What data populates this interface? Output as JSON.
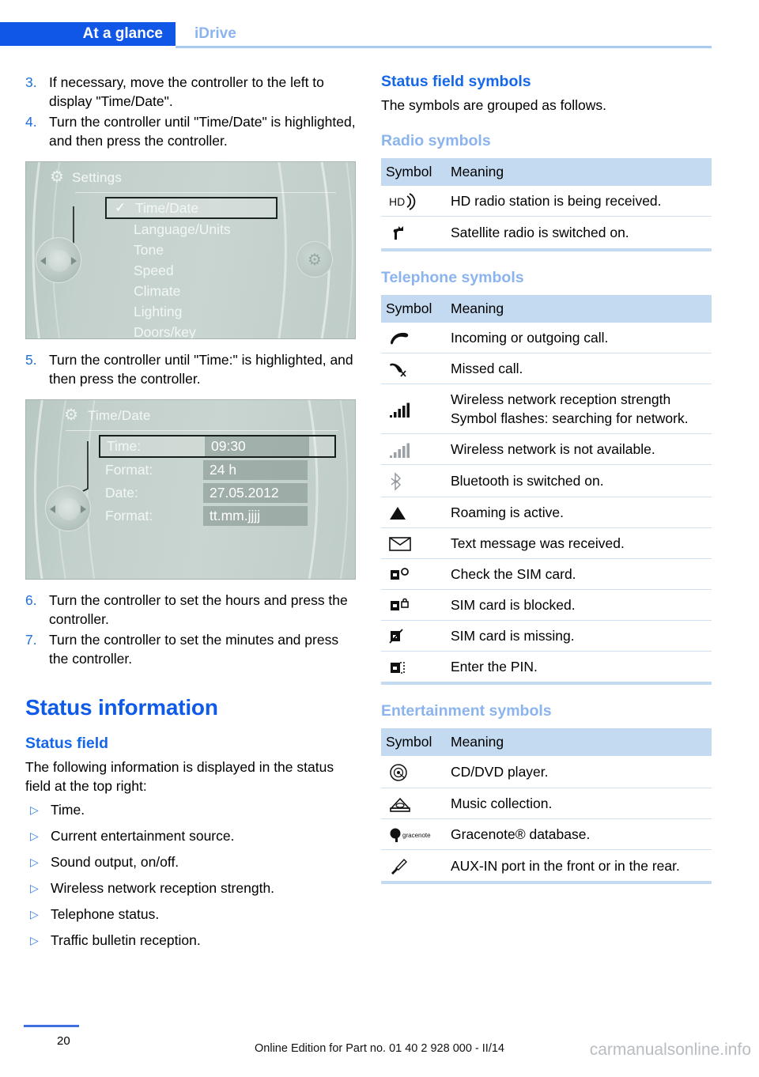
{
  "header": {
    "chapter_tab": "At a glance",
    "section": "iDrive"
  },
  "left_column": {
    "steps": [
      {
        "num": "3.",
        "text": "If necessary, move the controller to the left to display \"Time/Date\"."
      },
      {
        "num": "4.",
        "text": "Turn the controller until \"Time/Date\" is highlighted, and then press the controller."
      }
    ],
    "figure_settings": {
      "title": "Settings",
      "gear_icon": "gear-icon",
      "items": [
        {
          "label": "Time/Date",
          "selected": true,
          "checked": true
        },
        {
          "label": "Language/Units",
          "selected": false,
          "checked": false
        },
        {
          "label": "Tone",
          "selected": false,
          "checked": false
        },
        {
          "label": "Speed",
          "selected": false,
          "checked": false
        },
        {
          "label": "Climate",
          "selected": false,
          "checked": false
        },
        {
          "label": "Lighting",
          "selected": false,
          "checked": false
        },
        {
          "label": "Doors/key",
          "selected": false,
          "checked": false
        }
      ]
    },
    "step5": {
      "num": "5.",
      "text": "Turn the controller until \"Time:\" is highlighted, and then press the controller."
    },
    "figure_timedate": {
      "title": "Time/Date",
      "gear_icon": "gear-settings-icon",
      "rows": [
        {
          "label": "Time:",
          "value": "09:30",
          "selected": true
        },
        {
          "label": "Format:",
          "value": "24 h",
          "selected": false
        },
        {
          "label": "Date:",
          "value": "27.05.2012",
          "selected": false
        },
        {
          "label": "Format:",
          "value": "tt.mm.jjjj",
          "selected": false
        }
      ]
    },
    "steps_after": [
      {
        "num": "6.",
        "text": "Turn the controller to set the hours and press the controller."
      },
      {
        "num": "7.",
        "text": "Turn the controller to set the minutes and press the controller."
      }
    ],
    "status_information_heading": "Status information",
    "status_field_heading": "Status field",
    "status_field_intro": "The following information is displayed in the status field at the top right:",
    "status_field_items": [
      "Time.",
      "Current entertainment source.",
      "Sound output, on/off.",
      "Wireless network reception strength.",
      "Telephone status.",
      "Traffic bulletin reception."
    ],
    "bullet_glyph": "▷"
  },
  "right_column": {
    "status_field_symbols_heading": "Status field symbols",
    "status_field_symbols_intro": "The symbols are grouped as follows.",
    "radio_heading": "Radio symbols",
    "telephone_heading": "Telephone symbols",
    "entertainment_heading": "Entertainment symbols",
    "table_headers": {
      "symbol": "Symbol",
      "meaning": "Meaning"
    },
    "radio_rows": [
      {
        "icon": "hd-radio-icon",
        "meaning": "HD radio station is being received."
      },
      {
        "icon": "satellite-radio-icon",
        "meaning": "Satellite radio is switched on."
      }
    ],
    "telephone_rows": [
      {
        "icon": "phone-handset-icon",
        "meaning": "Incoming or outgoing call."
      },
      {
        "icon": "missed-call-icon",
        "meaning": "Missed call."
      },
      {
        "icon": "signal-bars-icon",
        "meaning": "Wireless network reception strength Symbol flashes: searching for network."
      },
      {
        "icon": "signal-bars-gray-icon",
        "meaning": "Wireless network is not available."
      },
      {
        "icon": "bluetooth-icon",
        "meaning": "Bluetooth is switched on."
      },
      {
        "icon": "roaming-triangle-icon",
        "meaning": "Roaming is active."
      },
      {
        "icon": "envelope-icon",
        "meaning": "Text message was received."
      },
      {
        "icon": "sim-check-icon",
        "meaning": "Check the SIM card."
      },
      {
        "icon": "sim-blocked-icon",
        "meaning": "SIM card is blocked."
      },
      {
        "icon": "sim-missing-icon",
        "meaning": "SIM card is missing."
      },
      {
        "icon": "sim-pin-icon",
        "meaning": "Enter the PIN."
      }
    ],
    "entertainment_rows": [
      {
        "icon": "cd-dvd-icon",
        "meaning": "CD/DVD player."
      },
      {
        "icon": "music-collection-icon",
        "meaning": "Music collection."
      },
      {
        "icon": "gracenote-icon",
        "meaning": "Gracenote® database.",
        "icon_text": "gracenote"
      },
      {
        "icon": "aux-in-icon",
        "meaning": "AUX-IN port in the front or in the rear."
      }
    ]
  },
  "footer": {
    "page_number": "20",
    "edition_note": "Online Edition for Part no. 01 40 2 928 000 - II/14",
    "watermark": "carmanualsonline.info"
  },
  "colors": {
    "accent_blue": "#1057e8",
    "light_blue": "#8bb4ef",
    "table_header_bg": "#c3daf1",
    "rule_blue": "#a9cbf0"
  }
}
